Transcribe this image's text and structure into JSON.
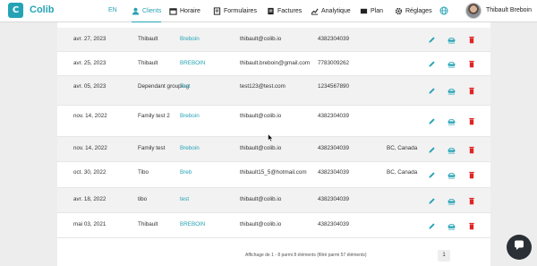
{
  "app": {
    "name": "Colib",
    "logo_letter": "C"
  },
  "nav": {
    "lang": "EN",
    "items": [
      {
        "label": "Clients",
        "icon": "users-icon",
        "active": true
      },
      {
        "label": "Horaire",
        "icon": "calendar-icon"
      },
      {
        "label": "Formulaires",
        "icon": "forms-icon"
      },
      {
        "label": "Factures",
        "icon": "invoice-icon"
      },
      {
        "label": "Analytique",
        "icon": "chart-icon"
      },
      {
        "label": "Plan",
        "icon": "map-icon"
      },
      {
        "label": "Réglages",
        "icon": "gear-icon"
      }
    ],
    "user": "Thibault Breboin"
  },
  "rows": [
    {
      "date": "avr. 27, 2023",
      "first": "Thibault",
      "last": "Breboin",
      "email": "thibault@colib.io",
      "phone": "4382304039",
      "region": ""
    },
    {
      "date": "avr. 25, 2023",
      "first": "Thibault",
      "last": "BREBOIN",
      "email": "thibault.breboin@gmail.com",
      "phone": "7783009262",
      "region": ""
    },
    {
      "date": "avr. 05, 2023",
      "first": "Dependant grouping",
      "last": "Test",
      "email": "test123@test.com",
      "phone": "1234567890",
      "region": ""
    },
    {
      "date": "nov. 14, 2022",
      "first": "Family test 2",
      "last": "Breboin",
      "email": "thibault@colib.io",
      "phone": "4382304039",
      "region": ""
    },
    {
      "date": "nov. 14, 2022",
      "first": "Family test",
      "last": "Breboin",
      "email": "thibault@colib.io",
      "phone": "4382304039",
      "region": "BC, Canada"
    },
    {
      "date": "oct. 30, 2022",
      "first": "Tibo",
      "last": "Breb",
      "email": "thibault15_5@hotmail.com",
      "phone": "4382304039",
      "region": "BC, Canada"
    },
    {
      "date": "avr. 18, 2022",
      "first": "tibo",
      "last": "test",
      "email": "thibault@colib.io",
      "phone": "4382304039",
      "region": ""
    },
    {
      "date": "mai 03, 2021",
      "first": "Thibault",
      "last": "BREBOIN",
      "email": "thibault@colib.io",
      "phone": "4382304039",
      "region": ""
    }
  ],
  "footer": {
    "summary": "Affichage de 1 - 8 parmi 8 éléments (filtré parmi 57 éléments)",
    "page": "1"
  },
  "colors": {
    "accent": "#25a3b5",
    "delete": "#e02424",
    "text": "#333333"
  }
}
